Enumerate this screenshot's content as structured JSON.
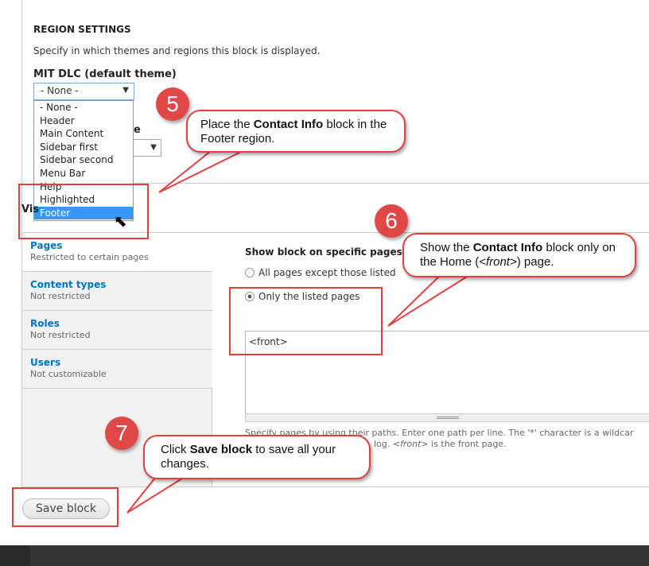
{
  "region": {
    "heading": "REGION SETTINGS",
    "description": "Specify in which themes and regions this block is displayed.",
    "theme_label": "MIT DLC (default theme)",
    "selected": "- None -",
    "options": [
      "- None -",
      "Header",
      "Main Content",
      "Sidebar first",
      "Sidebar second",
      "Menu Bar",
      "Help",
      "Highlighted",
      "Footer"
    ],
    "highlighted_option": "Footer",
    "second_label_tail": "e"
  },
  "visibility": {
    "heading_partial": "Vis"
  },
  "tabs": [
    {
      "title": "Pages",
      "summary": "Restricted to certain pages"
    },
    {
      "title": "Content types",
      "summary": "Not restricted"
    },
    {
      "title": "Roles",
      "summary": "Not restricted"
    },
    {
      "title": "Users",
      "summary": "Not customizable"
    }
  ],
  "pages": {
    "heading": "Show block on specific pages",
    "radio1": "All pages except those listed",
    "radio2": "Only the listed pages",
    "selected_radio": "Only the listed pages",
    "textarea_value": "<front>",
    "help_line1": "Specify pages by using their paths. Enter one path per line. The '*' character is a wildcar",
    "help_line2_tail": "log.",
    "help_front": "<front>",
    "help_line2_end": " is the front page."
  },
  "save_button": "Save block",
  "annotations": [
    {
      "number": "5",
      "pre": "Place the ",
      "bold": "Contact Info",
      "post": " block in the Footer region."
    },
    {
      "number": "6",
      "pre": "Show the ",
      "bold": "Contact Info",
      "mid": " block only on the Home (",
      "italic": "<front>",
      "post": ") page."
    },
    {
      "number": "7",
      "pre": "Click ",
      "bold": "Save block",
      "post": " to save all your changes."
    }
  ],
  "colors": {
    "annotation": "#e04040",
    "link": "#0074bd",
    "highlight": "#3399ff"
  }
}
